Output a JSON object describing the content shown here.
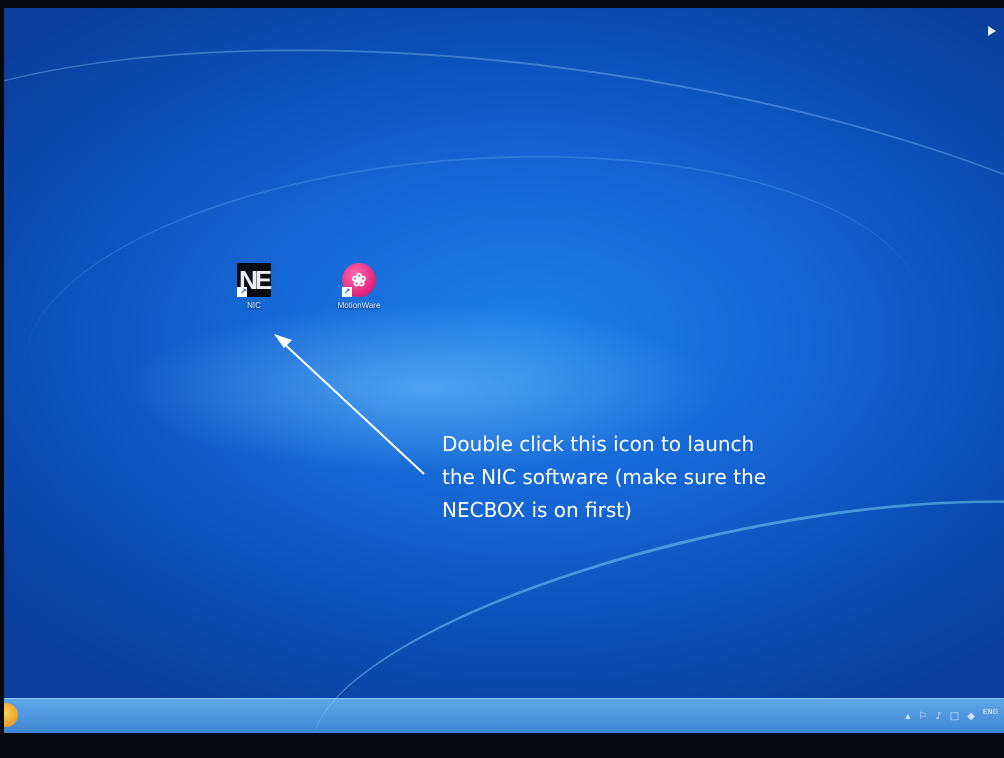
{
  "desktop": {
    "icons": [
      {
        "label": "NIC",
        "glyph": "NE",
        "icon": "nic-app-icon"
      },
      {
        "label": "MotionWare",
        "glyph": "❀",
        "icon": "motionware-app-icon"
      }
    ]
  },
  "annotation": {
    "lines": [
      "Double click this icon to launch",
      "the NIC software (make sure the",
      "NECBOX is on first)"
    ],
    "color": "#ffffff"
  },
  "taskbar": {
    "tray_icons": [
      "▴",
      "⚐",
      "♪",
      "□",
      "◆"
    ],
    "clock_time": "ENG",
    "clock_date": " "
  },
  "colors": {
    "desktop_blue": "#1566d4",
    "taskbar_blue": "#4f96de"
  }
}
